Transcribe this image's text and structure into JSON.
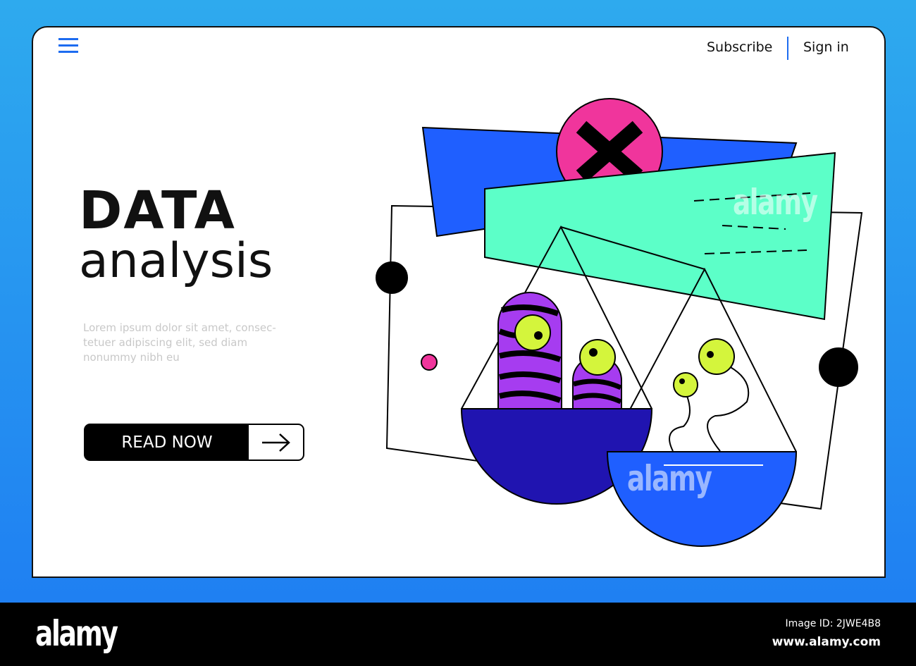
{
  "header": {
    "subscribe": "Subscribe",
    "sign_in": "Sign in"
  },
  "hero": {
    "title_line1": "DATA",
    "title_line2": "analysis",
    "body": "Lorem ipsum dolor sit amet, consec-tetuer adipiscing elit, sed diam nonummy nibh eu",
    "cta_label": "READ NOW"
  },
  "watermark": {
    "logo": "alamy",
    "image_id": "Image ID: 2JWE4B8",
    "url": "www.alamy.com"
  },
  "colors": {
    "accent": "#1d6cf0",
    "pink": "#f0359c",
    "mint": "#5cffc8",
    "blue": "#1f5fff",
    "navy": "#2014b0",
    "purple": "#a63cf0",
    "eye": "#d4f53c"
  }
}
